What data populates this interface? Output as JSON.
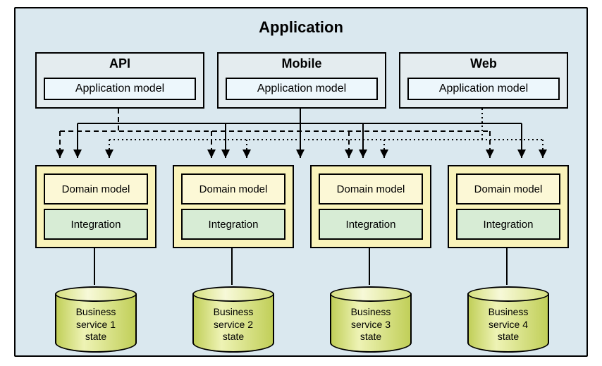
{
  "title": "Application",
  "clients": [
    {
      "name": "API",
      "model": "Application model"
    },
    {
      "name": "Mobile",
      "model": "Application model"
    },
    {
      "name": "Web",
      "model": "Application model"
    }
  ],
  "services": [
    {
      "domain": "Domain model",
      "integration": "Integration"
    },
    {
      "domain": "Domain model",
      "integration": "Integration"
    },
    {
      "domain": "Domain model",
      "integration": "Integration"
    },
    {
      "domain": "Domain model",
      "integration": "Integration"
    }
  ],
  "databases": [
    {
      "line1": "Business",
      "line2": "service 1",
      "line3": "state"
    },
    {
      "line1": "Business",
      "line2": "service 2",
      "line3": "state"
    },
    {
      "line1": "Business",
      "line2": "service 3",
      "line3": "state"
    },
    {
      "line1": "Business",
      "line2": "service 4",
      "line3": "state"
    }
  ]
}
